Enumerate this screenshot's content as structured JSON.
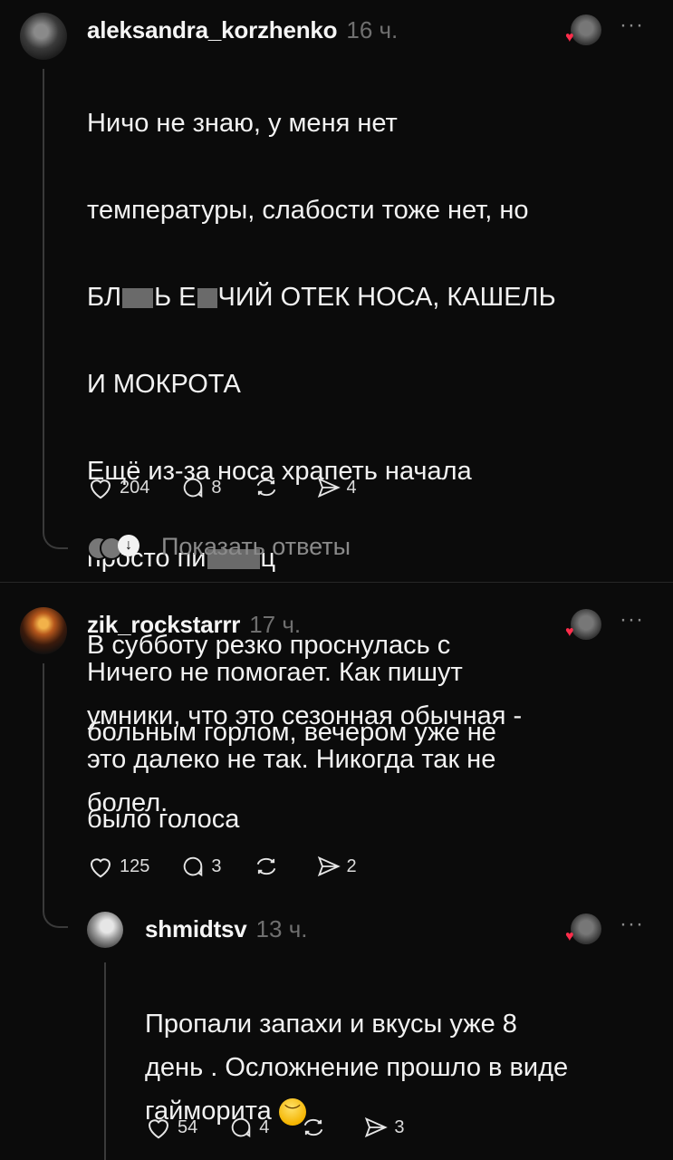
{
  "comments": [
    {
      "username": "aleksandra_korzhenko",
      "time": "16 ч.",
      "text_lines": [
        "Ничо не знаю, у меня нет",
        "температуры, слабости тоже нет, но",
        "БЛ",
        "И МОКРОТА",
        "Ещё из-за носа храпеть начала",
        "просто пи",
        "В субботу резко проснулась с",
        "больным горлом, вечером уже не",
        "было голоса"
      ],
      "censored_line_parts": [
        "БЛ",
        "Ь Е",
        "ЧИЙ ОТЕК НОСА, КАШЕЛЬ"
      ],
      "censored_line2_parts": [
        "просто пи",
        "ц"
      ],
      "likes": "204",
      "replies": "8",
      "shares": "4",
      "show_replies": "Показать ответы"
    },
    {
      "username": "zik_rockstarrr",
      "time": "17 ч.",
      "text": "Ничего не помогает. Как пишут\nумники, что это сезонная обычная -\nэто далеко не так. Никогда так не\nболел.",
      "likes": "125",
      "replies": "3",
      "shares": "2"
    },
    {
      "username": "shmidtsv",
      "time": "13 ч.",
      "text": "Пропали запахи и вкусы уже 8\nдень . Осложнение прошло в виде\nгайморита",
      "emoji": "disappointed-face",
      "likes": "54",
      "replies": "4",
      "shares": "3"
    }
  ],
  "more_label": "···",
  "colors": {
    "background": "#0b0b0b",
    "heart": "#ff2d4b",
    "muted": "#6f6f6f"
  }
}
